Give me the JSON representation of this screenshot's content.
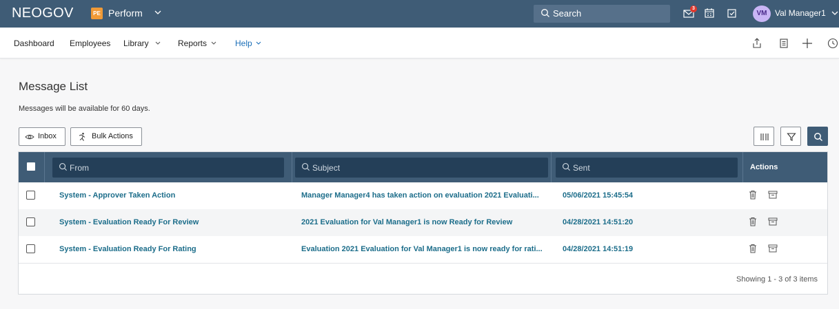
{
  "topbar": {
    "brand": "NEOGOV",
    "product_badge": "PE",
    "product_name": "Perform",
    "search_placeholder": "Search",
    "notification_count": "3",
    "user_initials": "VM",
    "user_name": "Val Manager1"
  },
  "nav": {
    "items": [
      {
        "label": "Dashboard"
      },
      {
        "label": "Employees"
      },
      {
        "label": "Library"
      },
      {
        "label": "Reports"
      },
      {
        "label": "Help"
      }
    ]
  },
  "page": {
    "title": "Message List",
    "subtitle": "Messages will be available for 60 days."
  },
  "toolbar": {
    "inbox_label": "Inbox",
    "bulk_actions_label": "Bulk Actions"
  },
  "table": {
    "columns": {
      "from_placeholder": "From",
      "subject_placeholder": "Subject",
      "sent_placeholder": "Sent",
      "actions": "Actions"
    },
    "rows": [
      {
        "from": "System - Approver Taken Action",
        "subject": "Manager Manager4 has taken action on evaluation 2021 Evaluati...",
        "sent": "05/06/2021 15:45:54"
      },
      {
        "from": "System - Evaluation Ready For Review",
        "subject": "2021 Evaluation for Val Manager1 is now Ready for Review",
        "sent": "04/28/2021 14:51:20"
      },
      {
        "from": "System - Evaluation Ready For Rating",
        "subject": "Evaluation 2021 Evaluation for Val Manager1 is now ready for rati...",
        "sent": "04/28/2021 14:51:19"
      }
    ],
    "paging": "Showing 1 - 3 of 3 items"
  },
  "colors": {
    "header_bg": "#3f5c76",
    "filter_bg": "#243f58",
    "link": "#1c6d8a",
    "badge": "#e0392e",
    "product_badge": "#f09a36"
  }
}
